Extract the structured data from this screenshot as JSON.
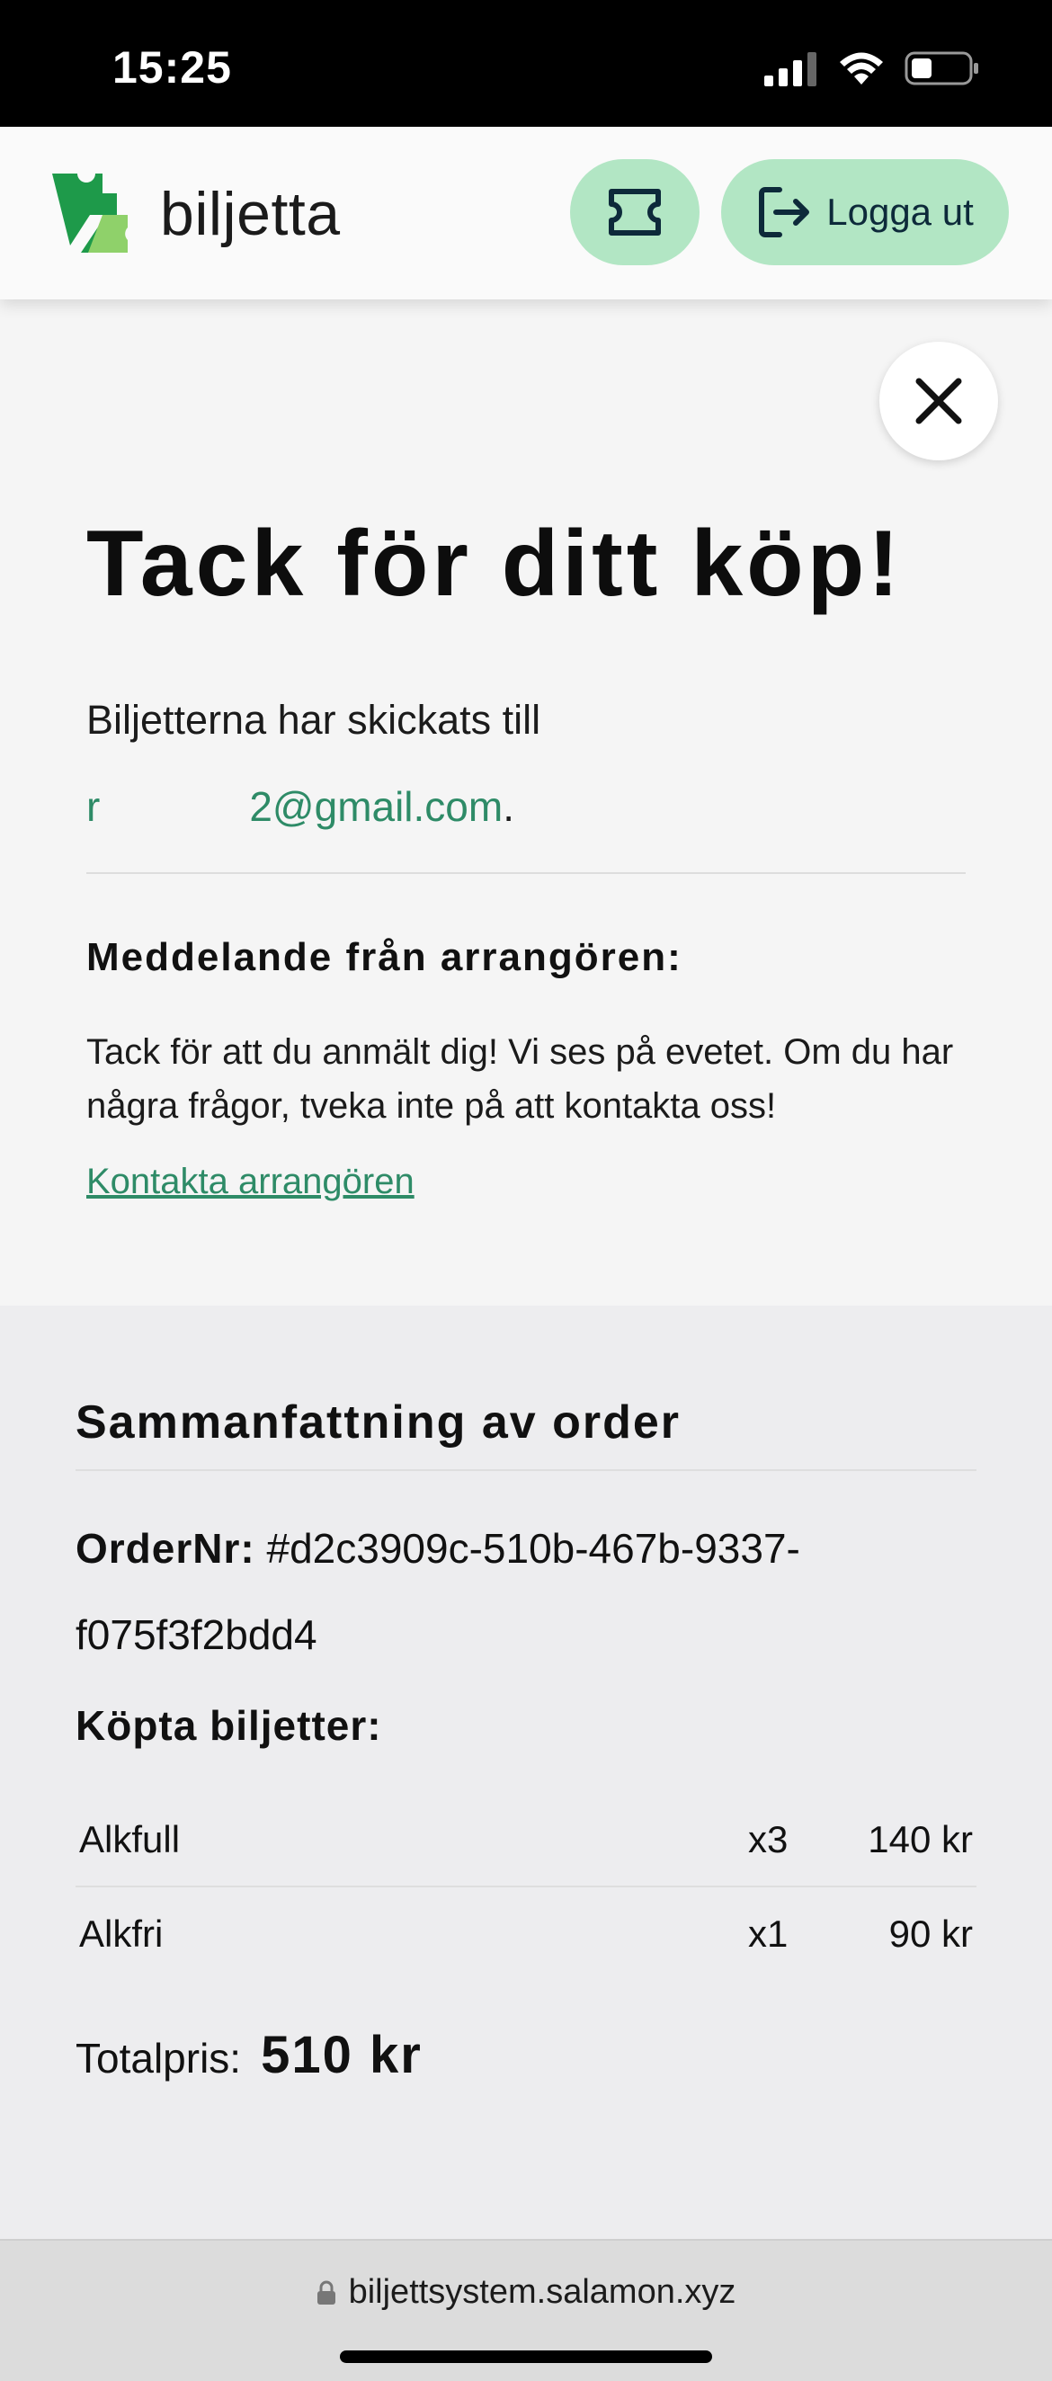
{
  "status_bar": {
    "time": "15:25"
  },
  "header": {
    "brand": "biljetta",
    "logout_label": "Logga ut"
  },
  "confirmation": {
    "title": "Tack för ditt köp!",
    "sent_text": "Biljetterna har skickats till",
    "email_start": "r",
    "email_end": "2@gmail.com",
    "email_suffix": ".",
    "message_heading": "Meddelande från arrangören:",
    "message_body": "Tack för att du anmält dig! Vi ses på evetet. Om du har några frågor, tveka inte på att kontakta oss!",
    "contact_link": "Kontakta arrangören"
  },
  "summary": {
    "title": "Sammanfattning av order",
    "order_label": "OrderNr:",
    "order_value": "#d2c3909c-510b-467b-9337-f075f3f2bdd4",
    "purchased_label": "Köpta biljetter:",
    "tickets": [
      {
        "name": "Alkfull",
        "qty": "x3",
        "price": "140 kr"
      },
      {
        "name": "Alkfri",
        "qty": "x1",
        "price": "90 kr"
      }
    ],
    "total_label": "Totalpris:",
    "total_value": "510 kr"
  },
  "browser": {
    "url": "biljettsystem.salamon.xyz"
  },
  "colors": {
    "accent": "#2e8b67",
    "button_bg": "#b2e6c4",
    "logo_dark": "#1e9a4a",
    "logo_light": "#8fd16a"
  }
}
